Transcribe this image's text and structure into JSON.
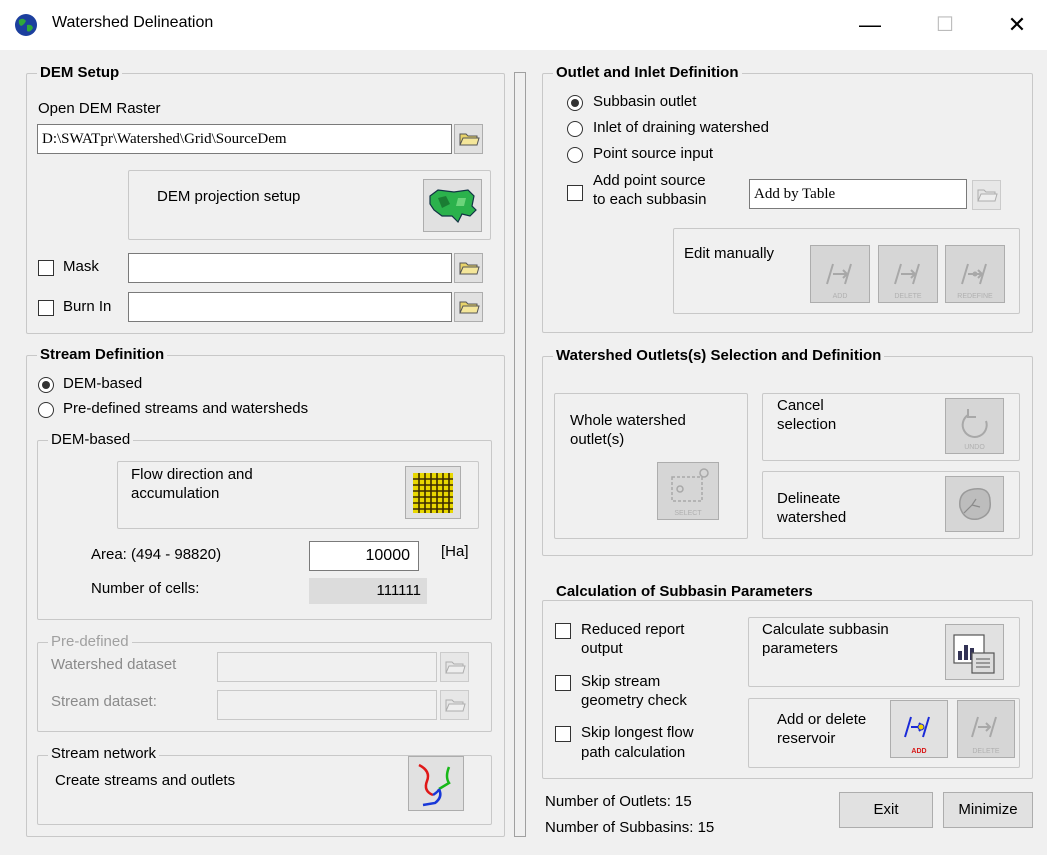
{
  "window": {
    "title": "Watershed Delineation",
    "minimize_symbol": "—",
    "maximize_symbol": "☐",
    "close_symbol": "✕"
  },
  "dem_setup": {
    "title": "DEM Setup",
    "open_label": "Open DEM Raster",
    "dem_path": "D:\\SWATpr\\Watershed\\Grid\\SourceDem",
    "projection_label": "DEM projection setup",
    "mask_label": "Mask",
    "mask_value": "",
    "burnin_label": "Burn In",
    "burnin_value": ""
  },
  "stream_definition": {
    "title": "Stream Definition",
    "option_dem": "DEM-based",
    "option_predefined": "Pre-defined streams and watersheds",
    "dem_based": {
      "title": "DEM-based",
      "flow_label_1": "Flow direction and",
      "flow_label_2": "accumulation",
      "area_label": "Area: (494 - 98820)",
      "area_value": "10000",
      "area_unit": "[Ha]",
      "cells_label": "Number of cells:",
      "cells_value": "111111"
    },
    "predefined": {
      "title": "Pre-defined",
      "watershed_label": "Watershed dataset",
      "stream_label": "Stream dataset:"
    },
    "network": {
      "title": "Stream network",
      "create_label": "Create streams and outlets"
    }
  },
  "outlet_inlet": {
    "title": "Outlet and Inlet Definition",
    "option_subbasin": "Subbasin outlet",
    "option_inlet": "Inlet of draining watershed",
    "option_point": "Point source input",
    "add_point_1": "Add point source",
    "add_point_2": "to each subbasin",
    "add_by_table": "Add by Table",
    "edit_manually": "Edit manually",
    "add_caption": "ADD",
    "delete_caption": "DELETE",
    "redefine_caption": "REDEFINE"
  },
  "outlets_selection": {
    "title": "Watershed Outlets(s) Selection and Definition",
    "whole_1": "Whole watershed",
    "whole_2": "outlet(s)",
    "select_caption": "SELECT",
    "cancel_1": "Cancel",
    "cancel_2": "selection",
    "undo_caption": "UNDO",
    "delineate_1": "Delineate",
    "delineate_2": "watershed"
  },
  "subbasin_params": {
    "title": "Calculation of Subbasin Parameters",
    "reduced_1": "Reduced  report",
    "reduced_2": "output",
    "skip_geom_1": "Skip stream",
    "skip_geom_2": "geometry check",
    "skip_long_1": "Skip longest flow",
    "skip_long_2": "path calculation",
    "calc_1": "Calculate subbasin",
    "calc_2": "parameters",
    "res_1": "Add or delete",
    "res_2": "reservoir",
    "res_add_caption": "ADD",
    "res_delete_caption": "DELETE"
  },
  "footer": {
    "outlets_label": "Number of Outlets: 15",
    "subbasins_label": "Number of Subbasins: 15",
    "exit_label": "Exit",
    "minimize_label": "Minimize"
  },
  "colors": {
    "window_bg": "#f0f0f0",
    "group_border": "#c8c8c8",
    "disabled_text": "#a0a0a0"
  }
}
